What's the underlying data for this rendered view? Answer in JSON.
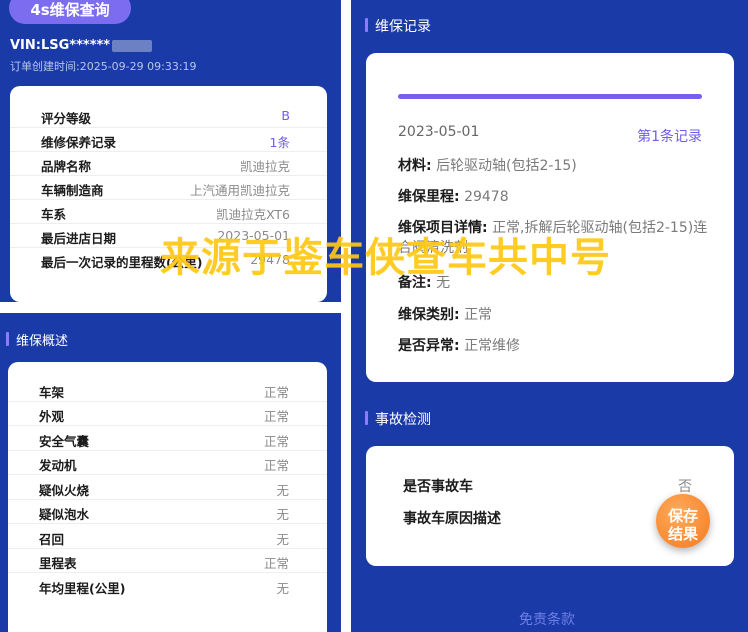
{
  "header": {
    "title": "4s维保查询",
    "vin_prefix": "VIN:LSG******",
    "created": "订单创建时间:2025-09-29 09:33:19"
  },
  "summary": {
    "rows": [
      {
        "label": "评分等级",
        "value": "B",
        "accent": true
      },
      {
        "label": "维修保养记录",
        "value": "1条",
        "accent": true
      },
      {
        "label": "品牌名称",
        "value": "凯迪拉克"
      },
      {
        "label": "车辆制造商",
        "value": "上汽通用凯迪拉克"
      },
      {
        "label": "车系",
        "value": "凯迪拉克XT6"
      },
      {
        "label": "最后进店日期",
        "value": "2023-05-01"
      },
      {
        "label": "最后一次记录的里程数(公里)",
        "value": "29478"
      }
    ]
  },
  "overview": {
    "title": "维保概述",
    "rows": [
      {
        "label": "车架",
        "value": "正常"
      },
      {
        "label": "外观",
        "value": "正常"
      },
      {
        "label": "安全气囊",
        "value": "正常"
      },
      {
        "label": "发动机",
        "value": "正常"
      },
      {
        "label": "疑似火烧",
        "value": "无"
      },
      {
        "label": "疑似泡水",
        "value": "无"
      },
      {
        "label": "召回",
        "value": "无"
      },
      {
        "label": "里程表",
        "value": "正常"
      },
      {
        "label": "年均里程(公里)",
        "value": "无"
      }
    ]
  },
  "records": {
    "title": "维保记录",
    "date": "2023-05-01",
    "record_no": "第1条记录",
    "material_label": "材料:",
    "material_value": "后轮驱动轴(包括2-15)",
    "mileage_label": "维保里程:",
    "mileage_value": "29478",
    "detail_label": "维保项目详情:",
    "detail_value": "正常,拆解后轮驱动轴(包括2-15)连合阀清洗剂",
    "note_label": "备注:",
    "note_value": "无",
    "type_label": "维保类别:",
    "type_value": "正常",
    "abnormal_label": "是否异常:",
    "abnormal_value": "正常维修"
  },
  "accident": {
    "title": "事故检测",
    "is_accident_label": "是否事故车",
    "is_accident_value": "否",
    "reason_label": "事故车原因描述"
  },
  "actions": {
    "save_line1": "保存",
    "save_line2": "结果",
    "disclaimer": "免责条款"
  },
  "watermark": "来源于鉴车侠查车共中号",
  "colors": {
    "background_blue": "#1a3aa8",
    "accent_purple": "#7b6cf0",
    "fab_orange": "#f47a1f",
    "watermark_yellow": "#ffc814"
  }
}
